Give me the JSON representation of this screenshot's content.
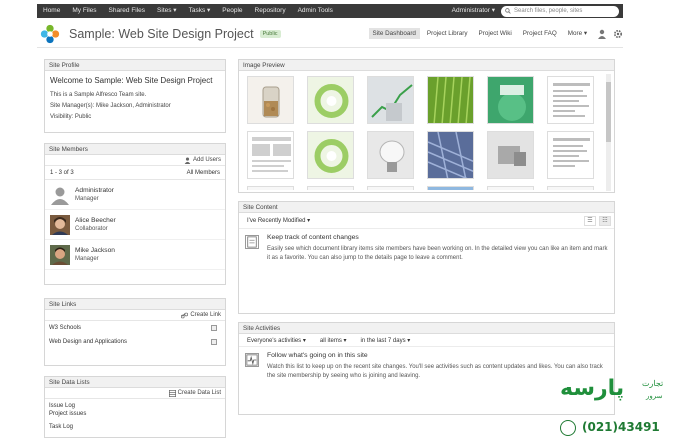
{
  "topnav": {
    "items": [
      "Home",
      "My Files",
      "Shared Files",
      "Sites ▾",
      "Tasks ▾",
      "People",
      "Repository",
      "Admin Tools"
    ],
    "user": "Administrator ▾",
    "search_placeholder": "Search files, people, sites"
  },
  "site": {
    "title": "Sample: Web Site Design Project",
    "badge": "Public",
    "nav": [
      "Site Dashboard",
      "Project Library",
      "Project Wiki",
      "Project FAQ",
      "More ▾"
    ]
  },
  "profile": {
    "title": "Site Profile",
    "welcome": "Welcome to Sample: Web Site Design Project",
    "description": "This is a Sample Alfresco Team site.",
    "managers": "Site Manager(s): Mike Jackson, Administrator",
    "visibility": "Visibility: Public"
  },
  "members": {
    "title": "Site Members",
    "add_users": "Add Users",
    "count": "1 - 3 of 3",
    "all_members": "All Members",
    "list": [
      {
        "name": "Administrator",
        "role": "Manager"
      },
      {
        "name": "Alice Beecher",
        "role": "Collaborator"
      },
      {
        "name": "Mike Jackson",
        "role": "Manager"
      }
    ]
  },
  "links": {
    "title": "Site Links",
    "create": "Create Link",
    "items": [
      "W3 Schools",
      "Web Design and Applications"
    ]
  },
  "datalists": {
    "title": "Site Data Lists",
    "create": "Create Data List",
    "items": [
      {
        "name": "Issue Log",
        "desc": "Project issues"
      },
      {
        "name": "Task Log",
        "desc": ""
      }
    ]
  },
  "image_preview": {
    "title": "Image Preview"
  },
  "content": {
    "title": "Site Content",
    "filter": "I've Recently Modified ▾",
    "heading": "Keep track of content changes",
    "text": "Easily see which document library items site members have been working on. In the detailed view you can like an item and mark it as a favorite. You can also jump to the details page to leave a comment."
  },
  "activities": {
    "title": "Site Activities",
    "filters": [
      "Everyone's activities ▾",
      "all items ▾",
      "in the last 7 days ▾"
    ],
    "heading": "Follow what's going on in this site",
    "text": "Watch this list to keep up on the recent site changes. You'll see activities such as content updates and likes. You can also track the site membership by seeing who is joining and leaving."
  },
  "watermark": {
    "brand": "پارسه",
    "sub1": "تجارت",
    "sub2": "سرور",
    "phone": "(021)43491"
  }
}
